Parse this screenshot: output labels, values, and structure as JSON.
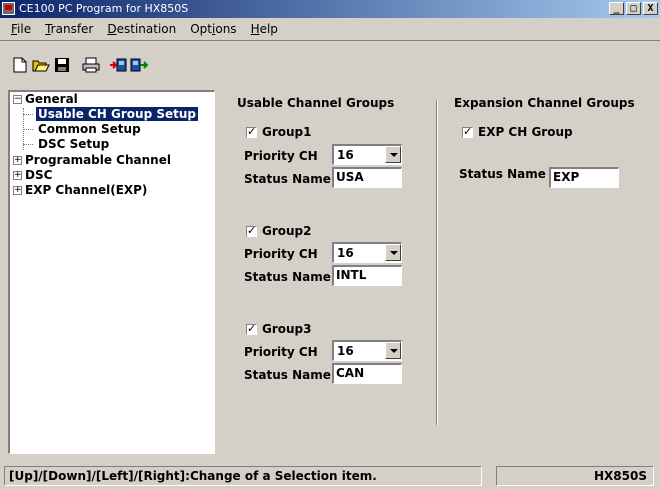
{
  "window": {
    "title": "CE100  PC Program for HX850S",
    "minimize": "_",
    "maximize": "□",
    "close": "X"
  },
  "menu": [
    {
      "key": "F",
      "rest": "ile"
    },
    {
      "key": "T",
      "rest": "ransfer"
    },
    {
      "key": "D",
      "rest": "estination"
    },
    {
      "pre": "Opt",
      "key": "i",
      "rest": "ons"
    },
    {
      "key": "H",
      "rest": "elp"
    }
  ],
  "toolbar": {
    "icons": [
      "new-file-icon",
      "open-folder-icon",
      "save-icon",
      "print-icon",
      "read-from-radio-icon",
      "write-to-radio-icon"
    ]
  },
  "tree": {
    "general": "General",
    "usable_ch": "Usable CH Group Setup",
    "common": "Common Setup",
    "dsc_setup": "DSC Setup",
    "programable": "Programable Channel",
    "dsc": "DSC",
    "exp": "EXP Channel(EXP)",
    "collapse_glyph": "−",
    "expand_glyph": "+"
  },
  "usable": {
    "heading": "Usable Channel Groups",
    "priority_label": "Priority CH",
    "status_label": "Status Name",
    "groups": [
      {
        "label": "Group1",
        "checked": true,
        "priority": "16",
        "status": "USA"
      },
      {
        "label": "Group2",
        "checked": true,
        "priority": "16",
        "status": "INTL"
      },
      {
        "label": "Group3",
        "checked": true,
        "priority": "16",
        "status": "CAN"
      }
    ]
  },
  "expansion": {
    "heading": "Expansion Channel Groups",
    "group_label": "EXP CH Group",
    "checked": true,
    "status_label": "Status Name",
    "status": "EXP"
  },
  "checkmark": "✓",
  "statusbar": {
    "hint": "[Up]/[Down]/[Left]/[Right]:Change of a Selection item.",
    "model": "HX850S"
  }
}
